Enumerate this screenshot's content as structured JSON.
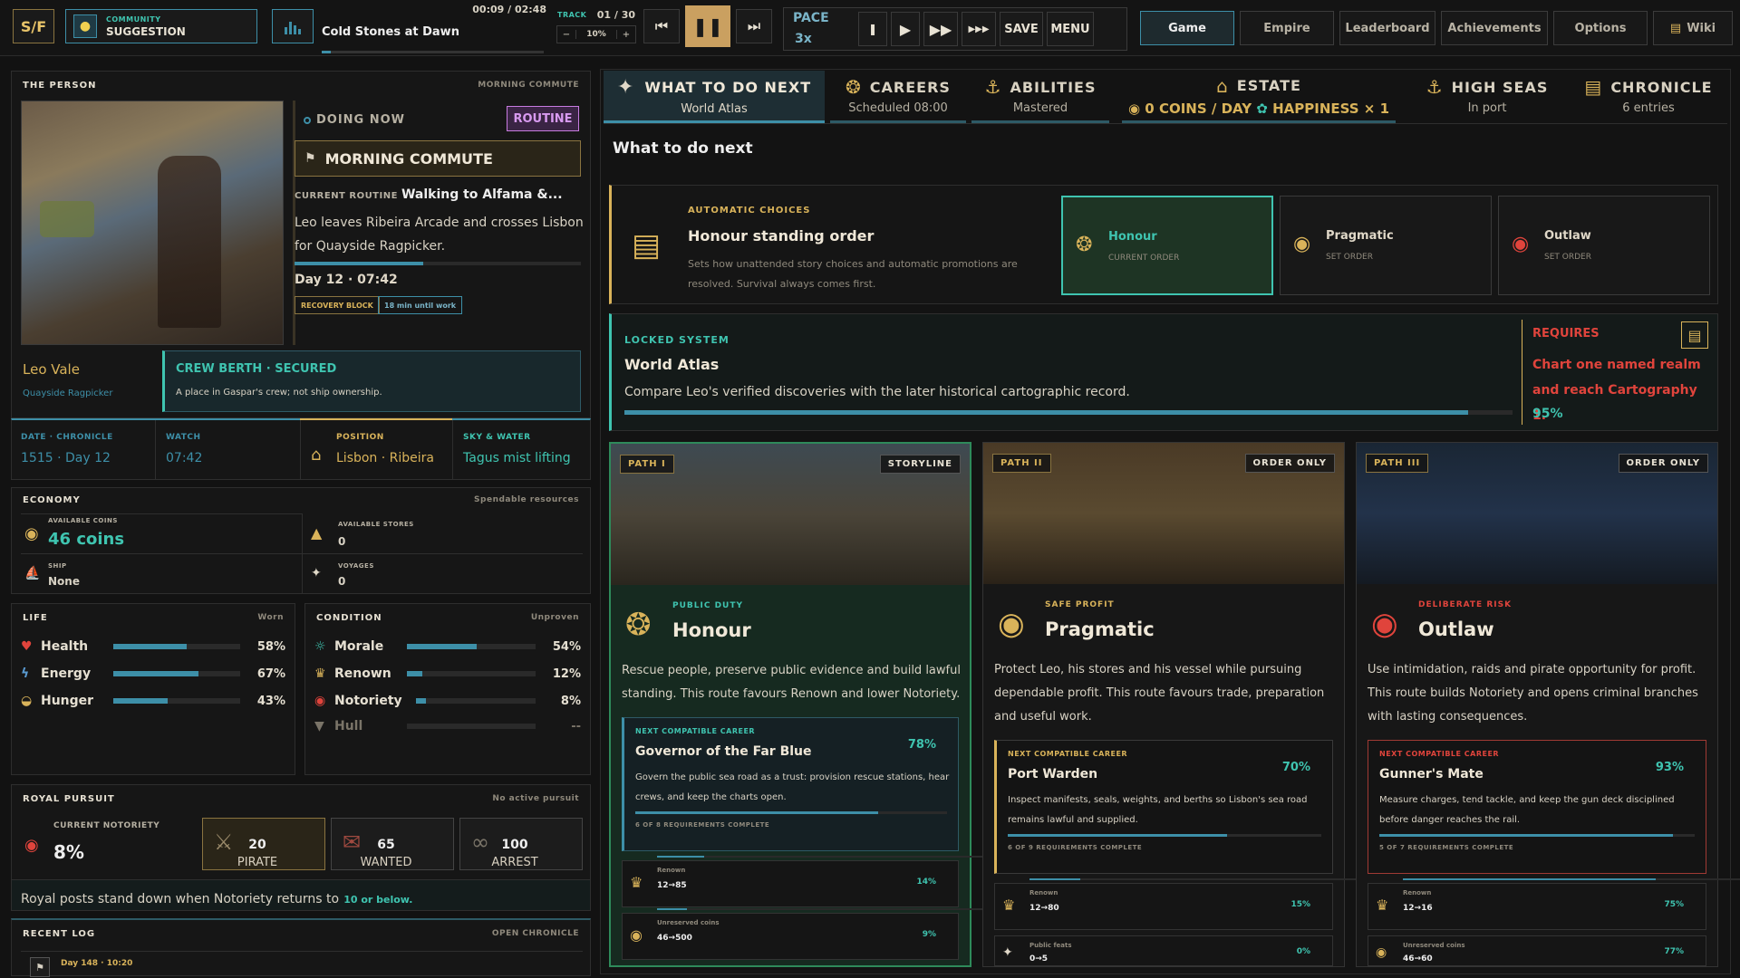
{
  "topbar": {
    "logo": "S/F",
    "community_label": "COMMUNITY",
    "suggestion_label": "SUGGESTION",
    "track_title": "Cold Stones at Dawn",
    "track_time": "00:09 / 02:48",
    "track_label": "TRACK",
    "track_count": "01 / 30",
    "volume_minus": "−",
    "volume_value": "10%",
    "volume_plus": "+",
    "pace_label": "PACE",
    "pace_value": "3x",
    "save_label": "SAVE",
    "menu_label": "MENU",
    "nav_tabs": [
      "Game",
      "Empire",
      "Leaderboard",
      "Achievements",
      "Options",
      "Wiki"
    ]
  },
  "person": {
    "header": "THE PERSON",
    "header_right": "MORNING COMMUTE",
    "doing_now": "DOING NOW",
    "routine_badge": "ROUTINE",
    "activity": "MORNING COMMUTE",
    "current_routine_label": "CURRENT ROUTINE",
    "current_routine_value": "Walking to Alfama &...",
    "description": "Leo leaves Ribeira Arcade and crosses Lisbon for Quayside Ragpicker.",
    "progress": 0.45,
    "day_time": "Day 12 · 07:42",
    "badge1": "RECOVERY BLOCK",
    "badge2": "18 min until work",
    "name": "Leo Vale",
    "role": "Quayside Ragpicker",
    "berth_title": "CREW BERTH · SECURED",
    "berth_desc": "A place in Gaspar's crew; not ship ownership."
  },
  "info": {
    "date_label": "DATE · CHRONICLE",
    "date_value": "1515 · Day 12",
    "watch_label": "WATCH",
    "watch_value": "07:42",
    "position_label": "POSITION",
    "position_value": "Lisbon · Ribeira",
    "sky_label": "SKY & WATER",
    "sky_value": "Tagus mist lifting"
  },
  "economy": {
    "header": "ECONOMY",
    "header_right": "Spendable resources",
    "coins_label": "AVAILABLE COINS",
    "coins_value": "46 coins",
    "stores_label": "AVAILABLE STORES",
    "stores_value": "0",
    "ship_label": "SHIP",
    "ship_value": "None",
    "voyages_label": "VOYAGES",
    "voyages_value": "0"
  },
  "life": {
    "header": "LIFE",
    "header_right": "Worn",
    "stats": [
      {
        "name": "Health",
        "pct": "58%",
        "v": 0.58
      },
      {
        "name": "Energy",
        "pct": "67%",
        "v": 0.67
      },
      {
        "name": "Hunger",
        "pct": "43%",
        "v": 0.43
      }
    ]
  },
  "condition": {
    "header": "CONDITION",
    "header_right": "Unproven",
    "stats": [
      {
        "name": "Morale",
        "pct": "54%",
        "v": 0.54
      },
      {
        "name": "Renown",
        "pct": "12%",
        "v": 0.12
      },
      {
        "name": "Notoriety",
        "pct": "8%",
        "v": 0.08
      },
      {
        "name": "Hull",
        "pct": "--",
        "v": 0
      }
    ]
  },
  "pursuit": {
    "header": "ROYAL PURSUIT",
    "header_right": "No active pursuit",
    "notoriety_label": "CURRENT NOTORIETY",
    "notoriety_value": "8%",
    "tiers": [
      {
        "num": "20",
        "name": "PIRATE"
      },
      {
        "num": "65",
        "name": "WANTED"
      },
      {
        "num": "100",
        "name": "ARREST"
      }
    ],
    "note": "Royal posts stand down when Notoriety returns to",
    "note_emph": "10 or below."
  },
  "log": {
    "header": "RECENT LOG",
    "header_right": "OPEN CHRONICLE",
    "entry": "Day 148 · 10:20"
  },
  "tabs": [
    {
      "title": "WHAT TO DO NEXT",
      "sub": "World Atlas"
    },
    {
      "title": "CAREERS",
      "sub": "Scheduled 08:00"
    },
    {
      "title": "ABILITIES",
      "sub": "Mastered"
    },
    {
      "title": "ESTATE",
      "sub": "0 COINS / DAY",
      "sub2": "HAPPINESS × 1"
    },
    {
      "title": "HIGH SEAS",
      "sub": "In port"
    },
    {
      "title": "CHRONICLE",
      "sub": "6 entries"
    }
  ],
  "main": {
    "heading": "What to do next",
    "auto_label": "AUTOMATIC CHOICES",
    "auto_title": "Honour standing order",
    "auto_desc": "Sets how unattended story choices and automatic promotions are resolved. Survival always comes first.",
    "orders": [
      {
        "name": "Honour",
        "sub": "CURRENT ORDER"
      },
      {
        "name": "Pragmatic",
        "sub": "SET ORDER"
      },
      {
        "name": "Outlaw",
        "sub": "SET ORDER"
      }
    ],
    "locked_label": "LOCKED SYSTEM",
    "locked_title": "World Atlas",
    "locked_desc": "Compare Leo's verified discoveries with the later historical cartographic record.",
    "locked_progress": 0.95,
    "requires_label": "REQUIRES",
    "requires_text": "Chart one named realm and reach Cartography 1.",
    "requires_pct": "95%"
  },
  "paths": [
    {
      "tag": "PATH I",
      "tag2": "STORYLINE",
      "kicker": "PUBLIC DUTY",
      "name": "Honour",
      "desc": "Rescue people, preserve public evidence and build lawful standing. This route favours Renown and lower Notoriety.",
      "career_label": "NEXT COMPATIBLE CAREER",
      "career_name": "Governor of the Far Blue",
      "career_pct": "78%",
      "career_v": 0.78,
      "career_desc": "Govern the public sea road as a trust: provision rescue stations, hear crews, and keep the charts open.",
      "career_req": "6 OF 8 REQUIREMENTS COMPLETE",
      "reqs": [
        {
          "label": "Renown",
          "range": "12→85",
          "pct": "14%",
          "v": 0.14
        },
        {
          "label": "Unreserved coins",
          "range": "46→500",
          "pct": "9%",
          "v": 0.09
        }
      ]
    },
    {
      "tag": "PATH II",
      "tag2": "ORDER ONLY",
      "kicker": "SAFE PROFIT",
      "name": "Pragmatic",
      "desc": "Protect Leo, his stores and his vessel while pursuing dependable profit. This route favours trade, preparation and useful work.",
      "career_label": "NEXT COMPATIBLE CAREER",
      "career_name": "Port Warden",
      "career_pct": "70%",
      "career_v": 0.7,
      "career_desc": "Inspect manifests, seals, weights, and berths so Lisbon's sea road remains lawful and supplied.",
      "career_req": "6 OF 9 REQUIREMENTS COMPLETE",
      "reqs": [
        {
          "label": "Renown",
          "range": "12→80",
          "pct": "15%",
          "v": 0.15
        },
        {
          "label": "Public feats",
          "range": "0→5",
          "pct": "0%",
          "v": 0
        }
      ]
    },
    {
      "tag": "PATH III",
      "tag2": "ORDER ONLY",
      "kicker": "DELIBERATE RISK",
      "name": "Outlaw",
      "desc": "Use intimidation, raids and pirate opportunity for profit. This route builds Notoriety and opens criminal branches with lasting consequences.",
      "career_label": "NEXT COMPATIBLE CAREER",
      "career_name": "Gunner's Mate",
      "career_pct": "93%",
      "career_v": 0.93,
      "career_desc": "Measure charges, tend tackle, and keep the gun deck disciplined before danger reaches the rail.",
      "career_req": "5 OF 7 REQUIREMENTS COMPLETE",
      "reqs": [
        {
          "label": "Renown",
          "range": "12→16",
          "pct": "75%",
          "v": 0.75
        },
        {
          "label": "Unreserved coins",
          "range": "46→60",
          "pct": "77%",
          "v": 0.77
        }
      ]
    }
  ],
  "colors": {
    "accent": "#3d8fa8",
    "gold": "#d9b35a",
    "teal": "#3fc4b0",
    "red": "#e0443c",
    "routine": "#c77be0"
  }
}
